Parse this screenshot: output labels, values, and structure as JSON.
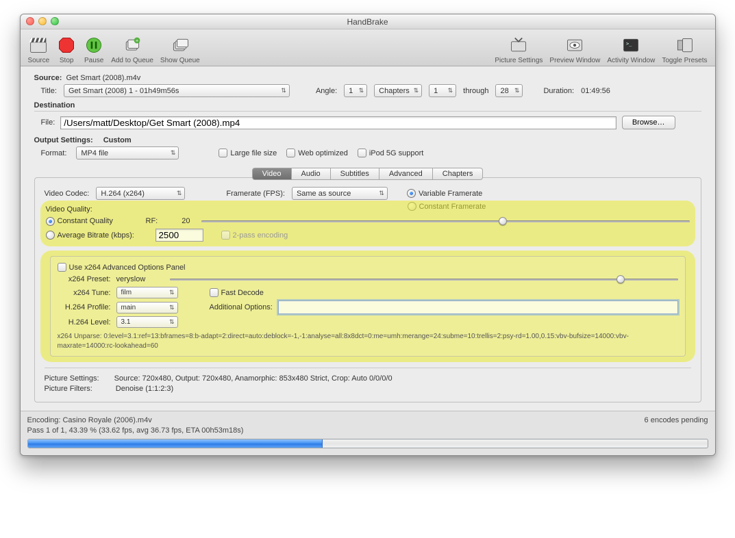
{
  "window": {
    "title": "HandBrake"
  },
  "toolbar": {
    "left": [
      "Source",
      "Stop",
      "Pause",
      "Add to Queue",
      "Show Queue"
    ],
    "right": [
      "Picture Settings",
      "Preview Window",
      "Activity Window",
      "Toggle Presets"
    ]
  },
  "source": {
    "label": "Source:",
    "value": "Get Smart (2008).m4v"
  },
  "title": {
    "label": "Title:",
    "selected": "Get Smart (2008) 1 - 01h49m56s"
  },
  "angle": {
    "label": "Angle:",
    "value": "1"
  },
  "range": {
    "type": "Chapters",
    "start": "1",
    "through_label": "through",
    "end": "28"
  },
  "duration": {
    "label": "Duration:",
    "value": "01:49:56"
  },
  "destination": {
    "header": "Destination",
    "file_label": "File:",
    "path": "/Users/matt/Desktop/Get Smart (2008).mp4",
    "browse_label": "Browse…"
  },
  "output": {
    "label": "Output Settings:",
    "preset": "Custom",
    "format_label": "Format:",
    "format": "MP4 file",
    "large_file": "Large file size",
    "web_optimized": "Web optimized",
    "ipod": "iPod 5G support"
  },
  "tabs": [
    "Video",
    "Audio",
    "Subtitles",
    "Advanced",
    "Chapters"
  ],
  "video": {
    "codec_label": "Video Codec:",
    "codec": "H.264 (x264)",
    "fps_label": "Framerate (FPS):",
    "fps": "Same as source",
    "vfr": "Variable Framerate",
    "cfr": "Constant Framerate",
    "quality_label": "Video Quality:",
    "cq_label": "Constant Quality",
    "rf_label": "RF:",
    "rf_value": "20",
    "abr_label": "Average Bitrate (kbps):",
    "abr_value": "2500",
    "two_pass": "2-pass encoding"
  },
  "x264": {
    "use_panel": "Use x264 Advanced Options Panel",
    "preset_label": "x264 Preset:",
    "preset": "veryslow",
    "tune_label": "x264 Tune:",
    "tune": "film",
    "fast_decode": "Fast Decode",
    "profile_label": "H.264 Profile:",
    "profile": "main",
    "additional_label": "Additional Options:",
    "level_label": "H.264 Level:",
    "level": "3.1",
    "unparse": "x264 Unparse: 0:level=3.1:ref=13:bframes=8:b-adapt=2:direct=auto:deblock=-1,-1:analyse=all:8x8dct=0:me=umh:merange=24:subme=10:trellis=2:psy-rd=1.00,0.15:vbv-bufsize=14000:vbv-maxrate=14000:rc-lookahead=60"
  },
  "picture": {
    "settings_label": "Picture Settings:",
    "settings": "Source: 720x480, Output: 720x480, Anamorphic: 853x480 Strict, Crop: Auto 0/0/0/0",
    "filters_label": "Picture Filters:",
    "filters": "Denoise (1:1:2:3)"
  },
  "status": {
    "encoding": "Encoding: Casino Royale (2006).m4v",
    "pending": "6 encodes pending",
    "pass": "Pass 1 of 1, 43.39 % (33.62 fps, avg 36.73 fps, ETA 00h53m18s)",
    "progress_percent": 43.39
  }
}
